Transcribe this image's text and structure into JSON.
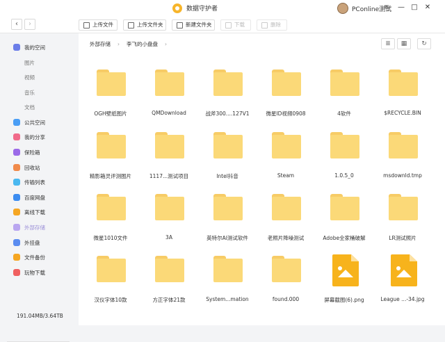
{
  "titlebar": {
    "title": "数据守护者",
    "user_name": "PConline测试",
    "controls": {
      "menu": "≡",
      "minimize": "—",
      "maximize": "□",
      "close": "✕"
    }
  },
  "toolbar": {
    "back": "‹",
    "forward": "›",
    "upload_file": "上传文件",
    "upload_folder": "上传文件夹",
    "new_folder": "新建文件夹",
    "download": "下载",
    "delete": "删除"
  },
  "sidebar": {
    "items": [
      {
        "label": "我的空间",
        "icon": "my-space-icon",
        "color": "#6b7de8"
      },
      {
        "label": "图片",
        "sub": true
      },
      {
        "label": "视频",
        "sub": true
      },
      {
        "label": "音乐",
        "sub": true
      },
      {
        "label": "文档",
        "sub": true
      },
      {
        "label": "公共空间",
        "icon": "public-space-icon",
        "color": "#4a9ef5"
      },
      {
        "label": "我的分享",
        "icon": "share-icon",
        "color": "#f06a8a"
      },
      {
        "label": "保险箱",
        "icon": "safe-icon",
        "color": "#9b6ae8"
      },
      {
        "label": "回收站",
        "icon": "trash-icon",
        "color": "#f08a4b"
      },
      {
        "label": "传输列表",
        "icon": "transfer-icon",
        "color": "#4ab8f0"
      },
      {
        "label": "百度网盘",
        "icon": "baidu-icon",
        "color": "#3b8cf0"
      },
      {
        "label": "离线下载",
        "icon": "offline-download-icon",
        "color": "#f5a623"
      },
      {
        "label": "外部存储",
        "icon": "external-storage-icon",
        "color": "#b9a6f0",
        "active": true
      },
      {
        "label": "外挂盘",
        "icon": "external-disk-icon",
        "color": "#5a8cf0"
      },
      {
        "label": "文件备份",
        "icon": "backup-icon",
        "color": "#f5a623"
      },
      {
        "label": "玩物下载",
        "icon": "wanwu-download-icon",
        "color": "#f06060"
      }
    ],
    "storage": "191.04MB/3.64TB"
  },
  "breadcrumb": {
    "root": "外部存储",
    "current": "李飞的小盘盘"
  },
  "files": [
    {
      "name": "OGH壁纸图片",
      "type": "folder"
    },
    {
      "name": "QMDownload",
      "type": "folder"
    },
    {
      "name": "战斧300....127V1",
      "type": "folder"
    },
    {
      "name": "微星ID视频0908",
      "type": "folder"
    },
    {
      "name": "4软件",
      "type": "folder"
    },
    {
      "name": "$RECYCLE.BIN",
      "type": "folder"
    },
    {
      "name": "精影箱灵评测图片",
      "type": "folder"
    },
    {
      "name": "1117...测试项目",
      "type": "folder"
    },
    {
      "name": "Intel抖音",
      "type": "folder"
    },
    {
      "name": "Steam",
      "type": "folder"
    },
    {
      "name": "1.0.5_0",
      "type": "folder"
    },
    {
      "name": "msdownld.tmp",
      "type": "folder"
    },
    {
      "name": "微星1010文件",
      "type": "folder"
    },
    {
      "name": "3A",
      "type": "folder"
    },
    {
      "name": "英特尔AI测试软件",
      "type": "folder"
    },
    {
      "name": "老照片降噪测试",
      "type": "folder"
    },
    {
      "name": "Adobe全家桶破解",
      "type": "folder"
    },
    {
      "name": "LR测试照片",
      "type": "folder"
    },
    {
      "name": "汉仪字体10款",
      "type": "folder"
    },
    {
      "name": "方正字体21款",
      "type": "folder"
    },
    {
      "name": "System...mation",
      "type": "folder"
    },
    {
      "name": "found.000",
      "type": "folder"
    },
    {
      "name": "屏幕截图(6).png",
      "type": "image"
    },
    {
      "name": "League ...-34.jpg",
      "type": "image"
    }
  ]
}
